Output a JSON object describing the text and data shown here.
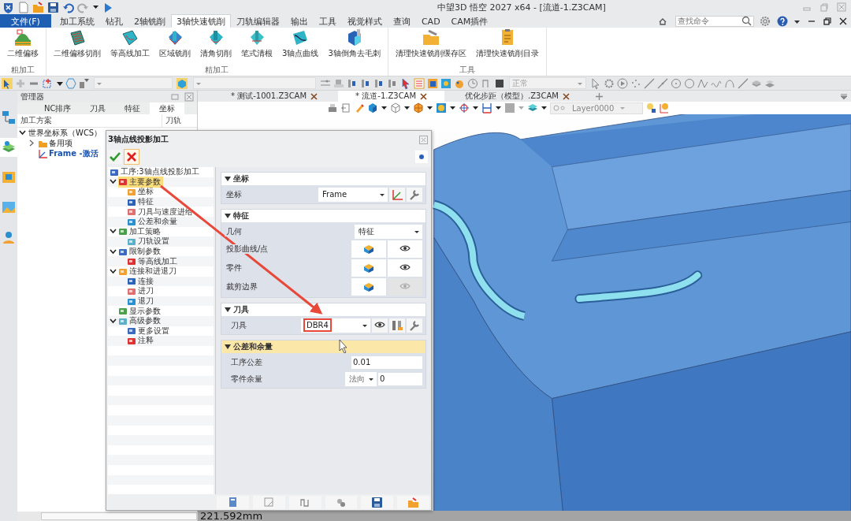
{
  "title_bar": {
    "title": "中望3D 悟空 2027 x64  - [流道-1.Z3CAM]"
  },
  "menu": [
    {
      "label": "文件(F)",
      "kind": "file",
      "selected": false
    },
    {
      "label": "加工系统",
      "kind": "tab",
      "selected": false
    },
    {
      "label": "钻孔",
      "kind": "tab",
      "selected": false
    },
    {
      "label": "2轴铣削",
      "kind": "tab",
      "selected": false
    },
    {
      "label": "3轴快速铣削",
      "kind": "tab",
      "selected": true
    },
    {
      "label": "刀轨编辑器",
      "kind": "tab",
      "selected": false
    },
    {
      "label": "输出",
      "kind": "tab",
      "selected": false
    },
    {
      "label": "工具",
      "kind": "tab",
      "selected": false
    },
    {
      "label": "视觉样式",
      "kind": "tab",
      "selected": false
    },
    {
      "label": "查询",
      "kind": "tab",
      "selected": false
    },
    {
      "label": "CAD",
      "kind": "tab",
      "selected": false
    },
    {
      "label": "CAM插件",
      "kind": "tab",
      "selected": false
    }
  ],
  "search": {
    "placeholder": "查找命令"
  },
  "ribbon": {
    "groups": [
      {
        "label": "粗加工",
        "buttons": [
          {
            "label": "二维偏移"
          }
        ]
      },
      {
        "label": "精加工",
        "buttons": [
          {
            "label": "二维偏移切削"
          },
          {
            "label": "等高线加工"
          },
          {
            "label": "区域铣削"
          },
          {
            "label": "清角切削"
          },
          {
            "label": "笔式清根"
          },
          {
            "label": "3轴点曲线"
          },
          {
            "label": "3轴倒角去毛刺"
          }
        ]
      },
      {
        "label": "工具",
        "buttons": [
          {
            "label": "清理快速铣削缓存区"
          },
          {
            "label": "清理快速铣削目录"
          }
        ]
      }
    ]
  },
  "toolbar": {
    "display_mode": "正常"
  },
  "manager": {
    "title": "管理器",
    "tabs": [
      {
        "label": "NC排序",
        "selected": false
      },
      {
        "label": "刀具",
        "selected": false
      },
      {
        "label": "特征",
        "selected": false
      },
      {
        "label": "坐标",
        "selected": true
      }
    ],
    "columns": [
      "加工方案",
      "刀轨"
    ],
    "tree": [
      {
        "label": "世界坐标系（WCS）",
        "expanded": true,
        "children": [
          {
            "label": "备用项",
            "kind": "folder",
            "expanded": false,
            "active": false
          },
          {
            "label": "Frame -激活",
            "kind": "frame",
            "active": true
          }
        ]
      }
    ]
  },
  "documents": {
    "tabs": [
      {
        "label": "* 测试-1001.Z3CAM",
        "selected": false
      },
      {
        "label": "* 流道-1.Z3CAM",
        "selected": true
      },
      {
        "label": "优化步距（模型）.Z3CAM",
        "selected": false
      }
    ],
    "layer": "Layer0000"
  },
  "dialog": {
    "title": "3轴点线投影加工",
    "tree": [
      {
        "label": "工序:3轴点线投影加工",
        "selected": false
      },
      {
        "label": "主要参数",
        "selected": true,
        "expanded": true,
        "children": [
          {
            "label": "坐标",
            "selected": false
          },
          {
            "label": "特征",
            "selected": false
          },
          {
            "label": "刀具与速度进给",
            "selected": false
          },
          {
            "label": "公差和余量",
            "selected": false
          }
        ]
      },
      {
        "label": "加工策略",
        "selected": false,
        "expanded": true,
        "children": [
          {
            "label": "刀轨设置",
            "selected": false
          }
        ]
      },
      {
        "label": "限制参数",
        "selected": false,
        "expanded": true,
        "children": [
          {
            "label": "等高线加工",
            "selected": false
          }
        ]
      },
      {
        "label": "连接和进退刀",
        "selected": false,
        "expanded": true,
        "children": [
          {
            "label": "连接",
            "selected": false
          },
          {
            "label": "进刀",
            "selected": false
          },
          {
            "label": "退刀",
            "selected": false
          }
        ]
      },
      {
        "label": "显示参数",
        "selected": false
      },
      {
        "label": "高级参数",
        "selected": false,
        "expanded": true,
        "children": [
          {
            "label": "更多设置",
            "selected": false
          },
          {
            "label": "注释",
            "selected": false
          }
        ]
      }
    ],
    "sections": [
      {
        "title": "坐标",
        "active": false,
        "rows": [
          {
            "label": "坐标",
            "kind": "frame-select",
            "value": "Frame",
            "highlighted": false
          }
        ]
      },
      {
        "title": "特征",
        "active": false,
        "rows": [
          {
            "label": "几何",
            "kind": "select",
            "value": "特征",
            "highlighted": false
          },
          {
            "label": "投影曲线/点",
            "kind": "pick",
            "eye_enabled": true,
            "highlighted": false
          },
          {
            "label": "零件",
            "kind": "pick",
            "eye_enabled": true,
            "highlighted": false
          },
          {
            "label": "裁剪边界",
            "kind": "pick",
            "eye_enabled": false,
            "highlighted": false
          }
        ]
      },
      {
        "title": "刀具",
        "active": false,
        "rows": [
          {
            "label": "刀具",
            "kind": "tool-select",
            "value": "DBR4",
            "highlighted": true
          }
        ]
      },
      {
        "title": "公差和余量",
        "active": true,
        "rows": [
          {
            "label": "工序公差",
            "kind": "number",
            "value": "0.01",
            "highlighted": false
          },
          {
            "label": "零件余量",
            "kind": "offset",
            "option": "法向",
            "value": "0",
            "highlighted": false
          }
        ]
      }
    ]
  },
  "status_bar": {
    "measure": "221.592mm"
  }
}
